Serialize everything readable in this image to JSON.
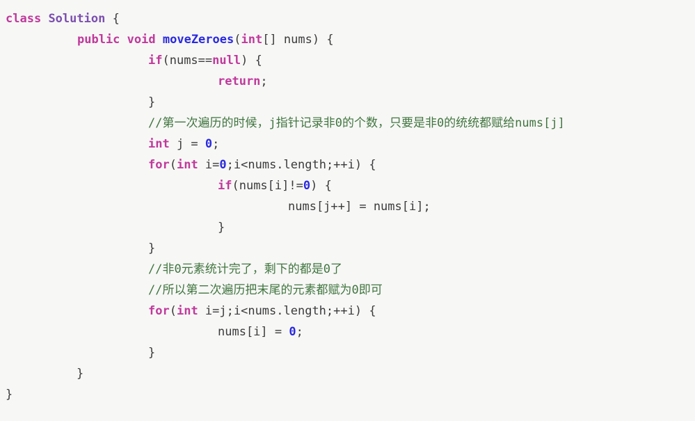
{
  "editor": {
    "language": "java",
    "background_color": "#f7f7f6",
    "default_text_color": "#3b3b3b",
    "theme_colors": {
      "keyword": "#c0399b",
      "class_name": "#7b4fae",
      "method_name": "#2a2adf",
      "number": "#2a2adf",
      "comment": "#41763f",
      "plain": "#3b3b3b"
    }
  },
  "code": {
    "lines": [
      {
        "indent": "i0",
        "tokens": [
          {
            "t": "class",
            "c": "tok-keyword"
          },
          {
            "t": " ",
            "c": "tok-plain"
          },
          {
            "t": "Solution",
            "c": "tok-classname"
          },
          {
            "t": " {",
            "c": "tok-punct"
          }
        ]
      },
      {
        "indent": "i1",
        "tokens": [
          {
            "t": "public",
            "c": "tok-keyword"
          },
          {
            "t": " ",
            "c": "tok-plain"
          },
          {
            "t": "void",
            "c": "tok-keyword"
          },
          {
            "t": " ",
            "c": "tok-plain"
          },
          {
            "t": "moveZeroes",
            "c": "tok-method"
          },
          {
            "t": "(",
            "c": "tok-punct"
          },
          {
            "t": "int",
            "c": "tok-type"
          },
          {
            "t": "[] nums) {",
            "c": "tok-punct"
          }
        ]
      },
      {
        "indent": "i2",
        "tokens": [
          {
            "t": "if",
            "c": "tok-keyword"
          },
          {
            "t": "(nums==",
            "c": "tok-punct"
          },
          {
            "t": "null",
            "c": "tok-keyword"
          },
          {
            "t": ") {",
            "c": "tok-punct"
          }
        ]
      },
      {
        "indent": "i3",
        "tokens": [
          {
            "t": "return",
            "c": "tok-keyword"
          },
          {
            "t": ";",
            "c": "tok-punct"
          }
        ]
      },
      {
        "indent": "i2",
        "tokens": [
          {
            "t": "}",
            "c": "tok-punct"
          }
        ]
      },
      {
        "indent": "i2",
        "tokens": [
          {
            "t": "//第一次遍历的时候，j指针记录非0的个数，只要是非0的统统都赋给nums[j]",
            "c": "tok-comment"
          }
        ]
      },
      {
        "indent": "i2",
        "tokens": [
          {
            "t": "int",
            "c": "tok-type"
          },
          {
            "t": " j = ",
            "c": "tok-punct"
          },
          {
            "t": "0",
            "c": "tok-number"
          },
          {
            "t": ";",
            "c": "tok-punct"
          }
        ]
      },
      {
        "indent": "i2",
        "tokens": [
          {
            "t": "for",
            "c": "tok-keyword"
          },
          {
            "t": "(",
            "c": "tok-punct"
          },
          {
            "t": "int",
            "c": "tok-type"
          },
          {
            "t": " i=",
            "c": "tok-punct"
          },
          {
            "t": "0",
            "c": "tok-number"
          },
          {
            "t": ";i<nums.length;++i) {",
            "c": "tok-punct"
          }
        ]
      },
      {
        "indent": "i3",
        "tokens": [
          {
            "t": "if",
            "c": "tok-keyword"
          },
          {
            "t": "(nums[i]!=",
            "c": "tok-punct"
          },
          {
            "t": "0",
            "c": "tok-number"
          },
          {
            "t": ") {",
            "c": "tok-punct"
          }
        ]
      },
      {
        "indent": "i4",
        "tokens": [
          {
            "t": "nums[j++] = nums[i];",
            "c": "tok-plain"
          }
        ]
      },
      {
        "indent": "i3",
        "tokens": [
          {
            "t": "}",
            "c": "tok-punct"
          }
        ]
      },
      {
        "indent": "i2",
        "tokens": [
          {
            "t": "}",
            "c": "tok-punct"
          }
        ]
      },
      {
        "indent": "i2",
        "tokens": [
          {
            "t": "//非0元素统计完了，剩下的都是0了",
            "c": "tok-comment"
          }
        ]
      },
      {
        "indent": "i2",
        "tokens": [
          {
            "t": "//所以第二次遍历把末尾的元素都赋为0即可",
            "c": "tok-comment"
          }
        ]
      },
      {
        "indent": "i2",
        "tokens": [
          {
            "t": "for",
            "c": "tok-keyword"
          },
          {
            "t": "(",
            "c": "tok-punct"
          },
          {
            "t": "int",
            "c": "tok-type"
          },
          {
            "t": " i=j;i<nums.length;++i) {",
            "c": "tok-punct"
          }
        ]
      },
      {
        "indent": "i3",
        "tokens": [
          {
            "t": "nums[i] = ",
            "c": "tok-plain"
          },
          {
            "t": "0",
            "c": "tok-number"
          },
          {
            "t": ";",
            "c": "tok-punct"
          }
        ]
      },
      {
        "indent": "i2",
        "tokens": [
          {
            "t": "}",
            "c": "tok-punct"
          }
        ]
      },
      {
        "indent": "i5",
        "tokens": [
          {
            "t": "}",
            "c": "tok-punct"
          }
        ]
      },
      {
        "indent": "i0",
        "tokens": [
          {
            "t": "}",
            "c": "tok-punct"
          }
        ]
      }
    ]
  }
}
